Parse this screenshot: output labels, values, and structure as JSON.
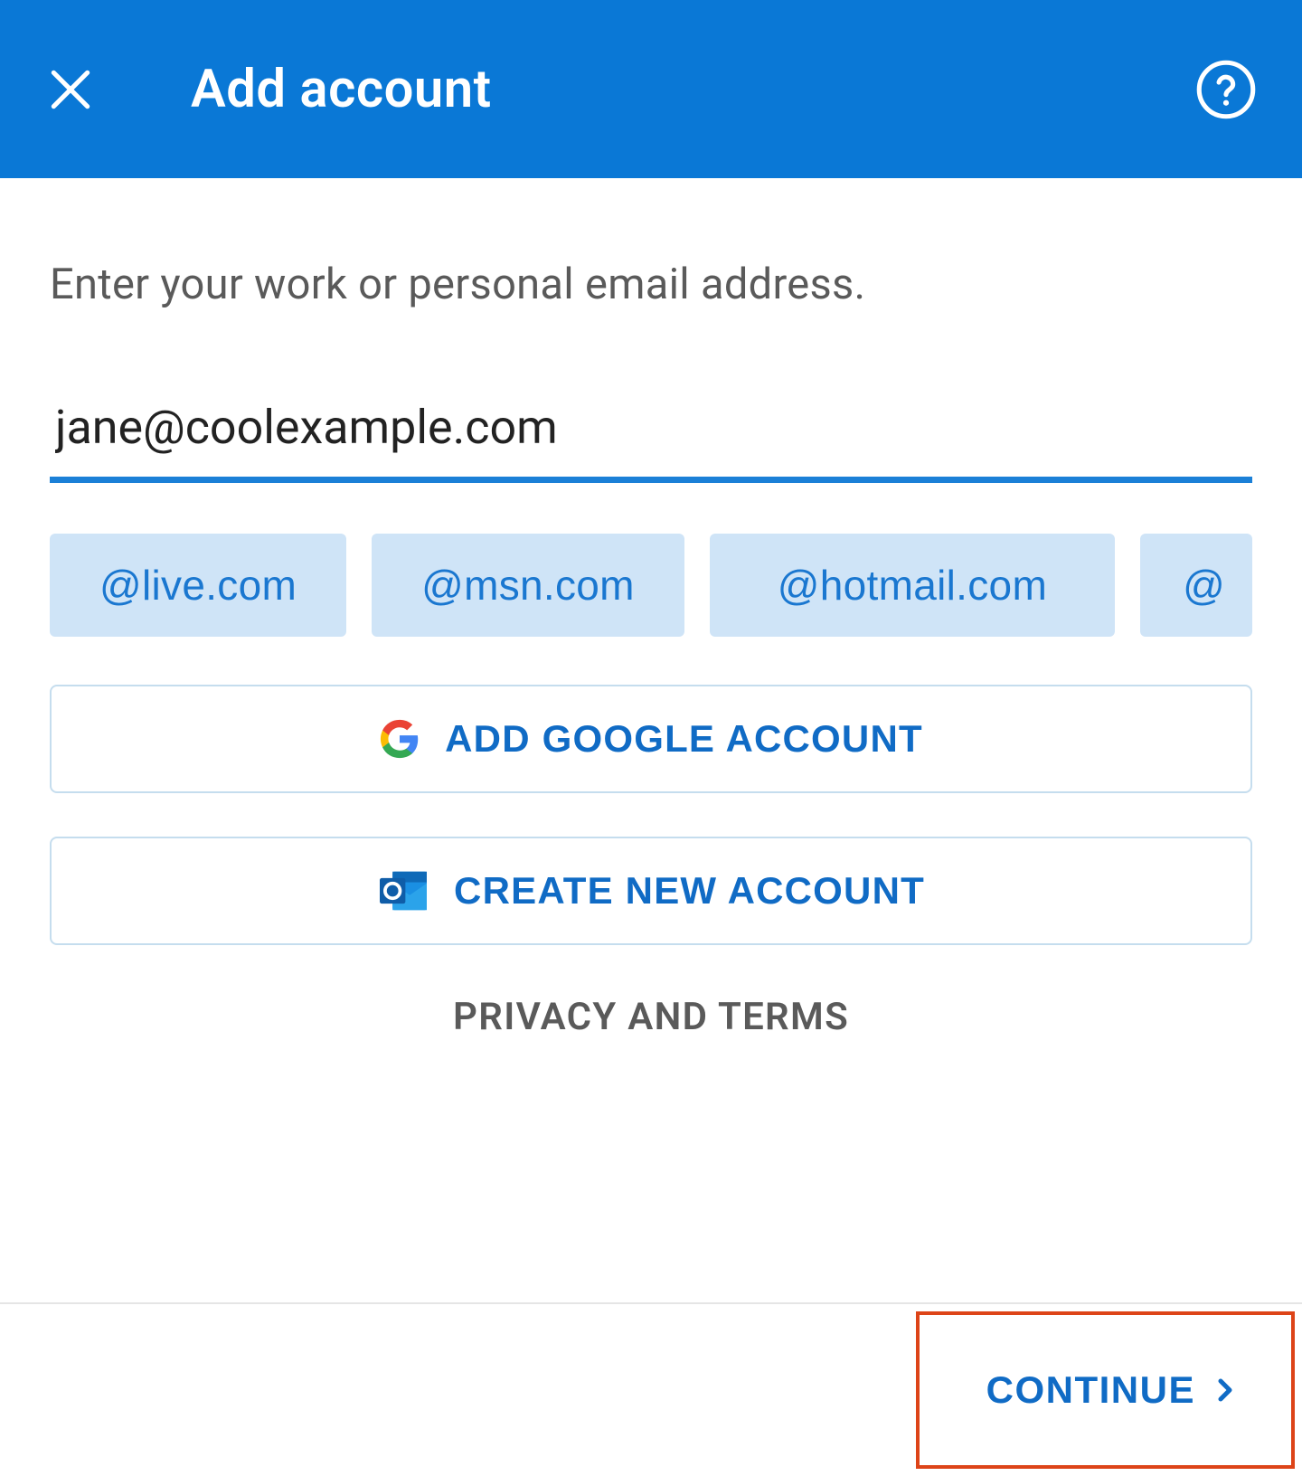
{
  "header": {
    "title": "Add account"
  },
  "content": {
    "instruction": "Enter your work or personal email address.",
    "email_value": "jane@coolexample.com",
    "domain_chips": [
      "@live.com",
      "@msn.com",
      "@hotmail.com",
      "@"
    ],
    "google_button": "ADD GOOGLE ACCOUNT",
    "create_button": "CREATE NEW ACCOUNT",
    "privacy_link": "PRIVACY AND TERMS"
  },
  "footer": {
    "continue_label": "CONTINUE"
  },
  "colors": {
    "primary": "#0a78d6",
    "accent": "#1b80d7",
    "highlight_border": "#dd4418"
  }
}
